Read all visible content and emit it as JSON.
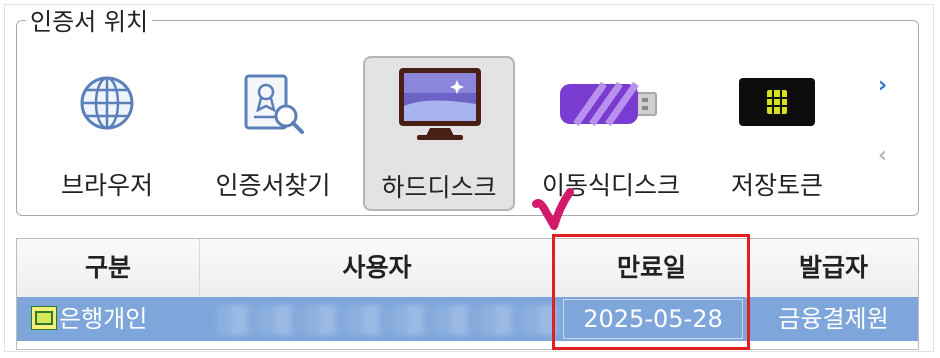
{
  "group": {
    "legend": "인증서 위치"
  },
  "storage": [
    {
      "label": "브라우저",
      "icon": "globe-icon"
    },
    {
      "label": "인증서찾기",
      "icon": "certificate-search-icon"
    },
    {
      "label": "하드디스크",
      "icon": "monitor-icon",
      "selected": true
    },
    {
      "label": "이동식디스크",
      "icon": "usb-drive-icon"
    },
    {
      "label": "저장토큰",
      "icon": "security-token-icon"
    }
  ],
  "nav": {
    "next": "›",
    "prev": "‹"
  },
  "table": {
    "headers": [
      "구분",
      "사용자",
      "만료일",
      "발급자"
    ],
    "rows": [
      {
        "type": "은행개인",
        "user": "",
        "expiry": "2025-05-28",
        "issuer": "금융결제원"
      }
    ]
  },
  "colors": {
    "row_selected": "#7ea6da",
    "highlight": "#e02020",
    "check": "#d11a6a"
  }
}
